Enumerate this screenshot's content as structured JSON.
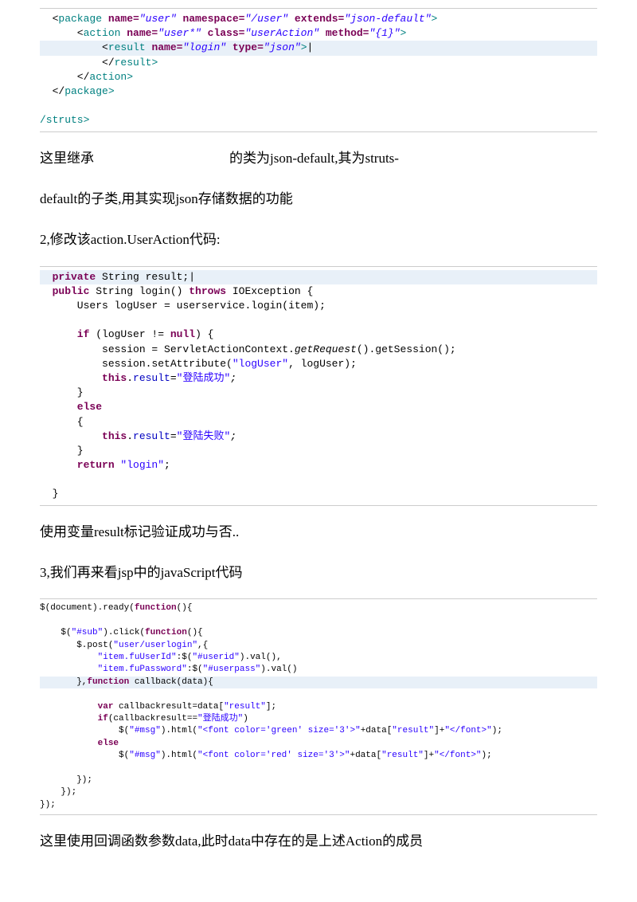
{
  "c1": {
    "l1a": "  <",
    "l1b": "package ",
    "l1c": "name=",
    "l1d": "\"user\"",
    "l1e": " namespace=",
    "l1f": "\"/user\"",
    "l1g": " extends=",
    "l1h": "\"json-default\"",
    "l1i": ">",
    "l2a": "      <",
    "l2b": "action ",
    "l2c": "name=",
    "l2d": "\"user*\"",
    "l2e": " class=",
    "l2f": "\"userAction\"",
    "l2g": " method=",
    "l2h": "\"{1}\"",
    "l2i": ">",
    "l3a": "          <",
    "l3b": "result ",
    "l3c": "name=",
    "l3d": "\"login\"",
    "l3e": " type=",
    "l3f": "\"json\"",
    "l3g": ">",
    "l4": "          </",
    "l4b": "result",
    "l4c": ">",
    "l5": "      </",
    "l5b": "action",
    "l5c": ">",
    "l6": "  </",
    "l6b": "package",
    "l6c": ">",
    "l7": "/struts>"
  },
  "p1a": "这里继承",
  "p1b": "的类为json-default,其为struts-",
  "p2": "default的子类,用其实现json存储数据的功能",
  "p3": "2,修改该action.UserAction代码:",
  "c2": {
    "l1a": "  private ",
    "l1b": "String result;",
    "l2a": "  public ",
    "l2b": "String login() ",
    "l2c": "throws ",
    "l2d": "IOException {",
    "l3a": "      Users logUser = ",
    "l3b": "userservice",
    "l3c": ".login(",
    "l3d": "item",
    "l3e": ");",
    "l4": "",
    "l5a": "      if ",
    "l5b": "(logUser != ",
    "l5c": "null",
    "l5d": ") {",
    "l6a": "          session = ServletActionContext.",
    "l6b": "getRequest",
    "l6c": "().getSession();",
    "l7a": "          session.setAttribute(",
    "l7b": "\"logUser\"",
    "l7c": ", logUser);",
    "l8a": "          this",
    "l8b": ".",
    "l8c": "result",
    "l8d": "=",
    "l8e": "\"登陆成功\"",
    "l8f": ";",
    "l9": "      }",
    "l10a": "      else",
    "l11": "      {",
    "l12a": "          this",
    "l12b": ".",
    "l12c": "result",
    "l12d": "=",
    "l12e": "\"登陆失败\"",
    "l12f": ";",
    "l13": "      }",
    "l14a": "      return ",
    "l14b": "\"login\"",
    "l14c": ";",
    "l15": "",
    "l16": "  }"
  },
  "p4": "使用变量result标记验证成功与否..",
  "p5": "3,我们再来看jsp中的javaScript代码",
  "c3": {
    "l1a": "$(document).ready(",
    "l1b": "function",
    "l1c": "(){",
    "l2": "",
    "l3a": "    $(",
    "l3b": "\"#sub\"",
    "l3c": ").click(",
    "l3d": "function",
    "l3e": "(){",
    "l4a": "       $.post(",
    "l4b": "\"user/userlogin\"",
    "l4c": ",{",
    "l5a": "           \"item.fuUserId\"",
    "l5b": ":$(",
    "l5c": "\"#userid\"",
    "l5d": ").val(),",
    "l6a": "           \"item.fuPassword\"",
    "l6b": ":$(",
    "l6c": "\"#userpass\"",
    "l6d": ").val()",
    "l7a": "       },",
    "l7b": "function ",
    "l7c": "callback(data){",
    "l8": "",
    "l9a": "           var ",
    "l9b": "callbackresult=data[",
    "l9c": "\"result\"",
    "l9d": "];",
    "l10a": "           if",
    "l10b": "(callbackresult==",
    "l10c": "\"登陆成功\"",
    "l10d": ")",
    "l11a": "               $(",
    "l11b": "\"#msg\"",
    "l11c": ").html(",
    "l11d": "\"<font color='green' size='3'>\"",
    "l11e": "+data[",
    "l11f": "\"result\"",
    "l11g": "]+",
    "l11h": "\"</font>\"",
    "l11i": ");",
    "l12a": "           else",
    "l13a": "               $(",
    "l13b": "\"#msg\"",
    "l13c": ").html(",
    "l13d": "\"<font color='red' size='3'>\"",
    "l13e": "+data[",
    "l13f": "\"result\"",
    "l13g": "]+",
    "l13h": "\"</font>\"",
    "l13i": ");",
    "l14": "",
    "l15": "       });",
    "l16": "    });",
    "l17": "});"
  },
  "p6": "这里使用回调函数参数data,此时data中存在的是上述Action的成员"
}
